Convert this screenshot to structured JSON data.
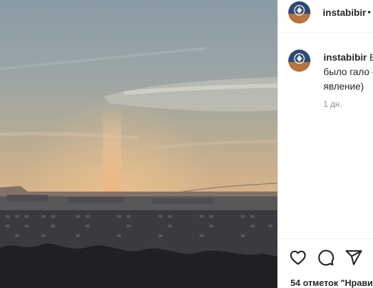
{
  "post": {
    "image_alt": "Закат над городом со световым столбом",
    "header": {
      "username": "instabibir",
      "separator": "•"
    },
    "caption": {
      "username": "instabibir",
      "line1_rest": "В",
      "line2": "было гало -",
      "line3": "явление)",
      "time": "1 дн."
    },
    "actions": {
      "like_icon": "heart-icon",
      "comment_icon": "speech-bubble-icon",
      "share_icon": "paper-plane-icon",
      "likes_text": "54 отметок \"Нрави"
    }
  },
  "colors": {
    "border": "#dbdbdb",
    "text": "#262626",
    "muted": "#8e8e8e"
  }
}
